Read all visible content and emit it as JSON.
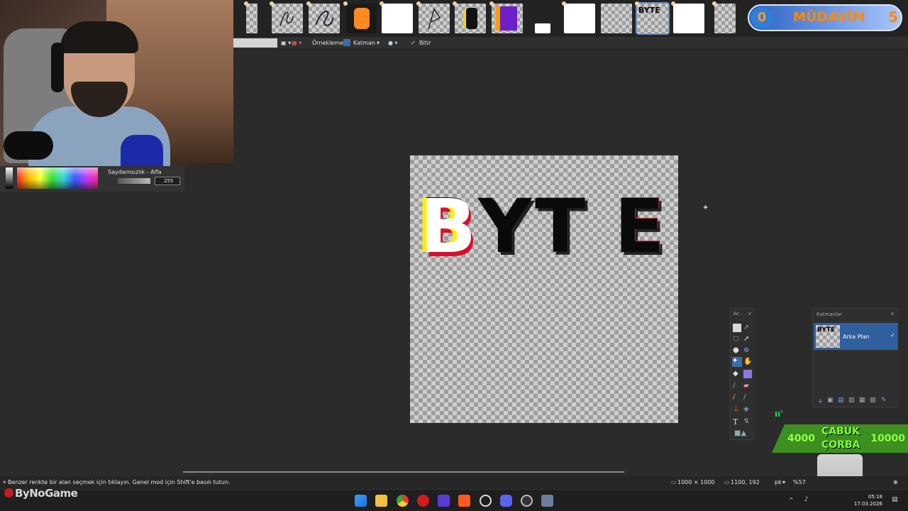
{
  "overlays": {
    "regular_badge": {
      "count_left": "0",
      "label": "MÜDAVİM",
      "count_right": "5"
    },
    "bonus": {
      "left_value": "4000",
      "title_line1": "ÇABUK",
      "title_line2": "ÇORBA",
      "right_value": "10000"
    },
    "watermark": "ByNoGame"
  },
  "options_bar": {
    "sampling_label": "Örnekleme:",
    "layer_option": "Katman",
    "finish_label": "Bitir"
  },
  "palette": {
    "alpha_label": "Saydamsızlık - Alfa",
    "alpha_value": "255"
  },
  "canvas": {
    "letters": [
      "B",
      "Y",
      "T",
      "E"
    ]
  },
  "tools_panel": {
    "title": "Ar..",
    "close": "×"
  },
  "layers_panel": {
    "title": "Katmanlar",
    "close": "×",
    "layer_name": "Arka Plan",
    "thumb_text": "BYTE"
  },
  "status": {
    "hint": "Benzer renkte bir alan seçmek için tıklayın. Genel mod için Shift'e basılı tutun.",
    "image_size": "1000 × 1000",
    "cursor_pos": "1100, 192",
    "unit": "pk",
    "zoom": "%57"
  },
  "taskbar": {
    "time": "05:18",
    "date": "17.03.2026"
  },
  "thumbnails": [
    {
      "name": "thumb-1"
    },
    {
      "name": "thumb-2"
    },
    {
      "name": "thumb-3"
    },
    {
      "name": "thumb-4"
    },
    {
      "name": "thumb-5"
    },
    {
      "name": "thumb-6"
    },
    {
      "name": "thumb-7"
    },
    {
      "name": "thumb-8"
    },
    {
      "name": "thumb-9"
    },
    {
      "name": "thumb-10"
    },
    {
      "name": "thumb-11"
    },
    {
      "name": "thumb-12"
    },
    {
      "name": "thumb-13"
    },
    {
      "name": "thumb-14"
    }
  ],
  "colors": {
    "accent": "#2f5f9c",
    "canvas_bg": "#2b2b2b",
    "yellow": "#ffef00",
    "red": "#d4112c"
  }
}
